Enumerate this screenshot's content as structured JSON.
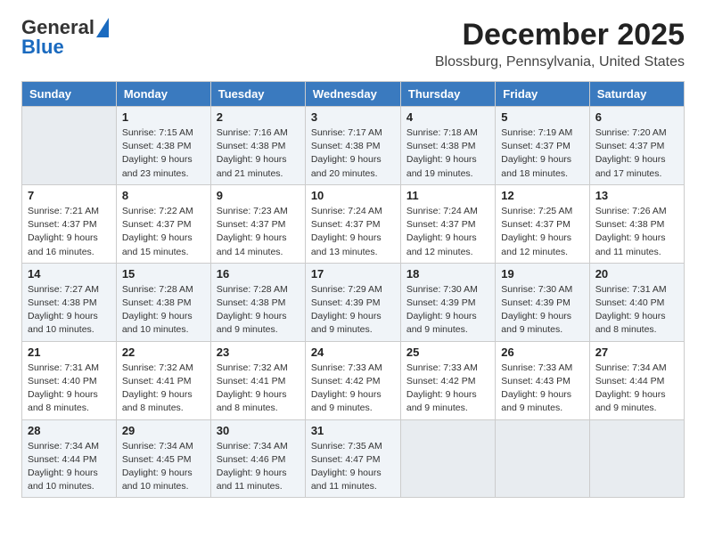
{
  "header": {
    "logo_line1": "General",
    "logo_line2": "Blue",
    "month": "December 2025",
    "location": "Blossburg, Pennsylvania, United States"
  },
  "columns": [
    "Sunday",
    "Monday",
    "Tuesday",
    "Wednesday",
    "Thursday",
    "Friday",
    "Saturday"
  ],
  "weeks": [
    [
      {
        "day": "",
        "empty": true
      },
      {
        "day": "1",
        "sunrise": "Sunrise: 7:15 AM",
        "sunset": "Sunset: 4:38 PM",
        "daylight": "Daylight: 9 hours and 23 minutes."
      },
      {
        "day": "2",
        "sunrise": "Sunrise: 7:16 AM",
        "sunset": "Sunset: 4:38 PM",
        "daylight": "Daylight: 9 hours and 21 minutes."
      },
      {
        "day": "3",
        "sunrise": "Sunrise: 7:17 AM",
        "sunset": "Sunset: 4:38 PM",
        "daylight": "Daylight: 9 hours and 20 minutes."
      },
      {
        "day": "4",
        "sunrise": "Sunrise: 7:18 AM",
        "sunset": "Sunset: 4:38 PM",
        "daylight": "Daylight: 9 hours and 19 minutes."
      },
      {
        "day": "5",
        "sunrise": "Sunrise: 7:19 AM",
        "sunset": "Sunset: 4:37 PM",
        "daylight": "Daylight: 9 hours and 18 minutes."
      },
      {
        "day": "6",
        "sunrise": "Sunrise: 7:20 AM",
        "sunset": "Sunset: 4:37 PM",
        "daylight": "Daylight: 9 hours and 17 minutes."
      }
    ],
    [
      {
        "day": "7",
        "sunrise": "Sunrise: 7:21 AM",
        "sunset": "Sunset: 4:37 PM",
        "daylight": "Daylight: 9 hours and 16 minutes."
      },
      {
        "day": "8",
        "sunrise": "Sunrise: 7:22 AM",
        "sunset": "Sunset: 4:37 PM",
        "daylight": "Daylight: 9 hours and 15 minutes."
      },
      {
        "day": "9",
        "sunrise": "Sunrise: 7:23 AM",
        "sunset": "Sunset: 4:37 PM",
        "daylight": "Daylight: 9 hours and 14 minutes."
      },
      {
        "day": "10",
        "sunrise": "Sunrise: 7:24 AM",
        "sunset": "Sunset: 4:37 PM",
        "daylight": "Daylight: 9 hours and 13 minutes."
      },
      {
        "day": "11",
        "sunrise": "Sunrise: 7:24 AM",
        "sunset": "Sunset: 4:37 PM",
        "daylight": "Daylight: 9 hours and 12 minutes."
      },
      {
        "day": "12",
        "sunrise": "Sunrise: 7:25 AM",
        "sunset": "Sunset: 4:37 PM",
        "daylight": "Daylight: 9 hours and 12 minutes."
      },
      {
        "day": "13",
        "sunrise": "Sunrise: 7:26 AM",
        "sunset": "Sunset: 4:38 PM",
        "daylight": "Daylight: 9 hours and 11 minutes."
      }
    ],
    [
      {
        "day": "14",
        "sunrise": "Sunrise: 7:27 AM",
        "sunset": "Sunset: 4:38 PM",
        "daylight": "Daylight: 9 hours and 10 minutes."
      },
      {
        "day": "15",
        "sunrise": "Sunrise: 7:28 AM",
        "sunset": "Sunset: 4:38 PM",
        "daylight": "Daylight: 9 hours and 10 minutes."
      },
      {
        "day": "16",
        "sunrise": "Sunrise: 7:28 AM",
        "sunset": "Sunset: 4:38 PM",
        "daylight": "Daylight: 9 hours and 9 minutes."
      },
      {
        "day": "17",
        "sunrise": "Sunrise: 7:29 AM",
        "sunset": "Sunset: 4:39 PM",
        "daylight": "Daylight: 9 hours and 9 minutes."
      },
      {
        "day": "18",
        "sunrise": "Sunrise: 7:30 AM",
        "sunset": "Sunset: 4:39 PM",
        "daylight": "Daylight: 9 hours and 9 minutes."
      },
      {
        "day": "19",
        "sunrise": "Sunrise: 7:30 AM",
        "sunset": "Sunset: 4:39 PM",
        "daylight": "Daylight: 9 hours and 9 minutes."
      },
      {
        "day": "20",
        "sunrise": "Sunrise: 7:31 AM",
        "sunset": "Sunset: 4:40 PM",
        "daylight": "Daylight: 9 hours and 8 minutes."
      }
    ],
    [
      {
        "day": "21",
        "sunrise": "Sunrise: 7:31 AM",
        "sunset": "Sunset: 4:40 PM",
        "daylight": "Daylight: 9 hours and 8 minutes."
      },
      {
        "day": "22",
        "sunrise": "Sunrise: 7:32 AM",
        "sunset": "Sunset: 4:41 PM",
        "daylight": "Daylight: 9 hours and 8 minutes."
      },
      {
        "day": "23",
        "sunrise": "Sunrise: 7:32 AM",
        "sunset": "Sunset: 4:41 PM",
        "daylight": "Daylight: 9 hours and 8 minutes."
      },
      {
        "day": "24",
        "sunrise": "Sunrise: 7:33 AM",
        "sunset": "Sunset: 4:42 PM",
        "daylight": "Daylight: 9 hours and 9 minutes."
      },
      {
        "day": "25",
        "sunrise": "Sunrise: 7:33 AM",
        "sunset": "Sunset: 4:42 PM",
        "daylight": "Daylight: 9 hours and 9 minutes."
      },
      {
        "day": "26",
        "sunrise": "Sunrise: 7:33 AM",
        "sunset": "Sunset: 4:43 PM",
        "daylight": "Daylight: 9 hours and 9 minutes."
      },
      {
        "day": "27",
        "sunrise": "Sunrise: 7:34 AM",
        "sunset": "Sunset: 4:44 PM",
        "daylight": "Daylight: 9 hours and 9 minutes."
      }
    ],
    [
      {
        "day": "28",
        "sunrise": "Sunrise: 7:34 AM",
        "sunset": "Sunset: 4:44 PM",
        "daylight": "Daylight: 9 hours and 10 minutes."
      },
      {
        "day": "29",
        "sunrise": "Sunrise: 7:34 AM",
        "sunset": "Sunset: 4:45 PM",
        "daylight": "Daylight: 9 hours and 10 minutes."
      },
      {
        "day": "30",
        "sunrise": "Sunrise: 7:34 AM",
        "sunset": "Sunset: 4:46 PM",
        "daylight": "Daylight: 9 hours and 11 minutes."
      },
      {
        "day": "31",
        "sunrise": "Sunrise: 7:35 AM",
        "sunset": "Sunset: 4:47 PM",
        "daylight": "Daylight: 9 hours and 11 minutes."
      },
      {
        "day": "",
        "empty": true
      },
      {
        "day": "",
        "empty": true
      },
      {
        "day": "",
        "empty": true
      }
    ]
  ]
}
